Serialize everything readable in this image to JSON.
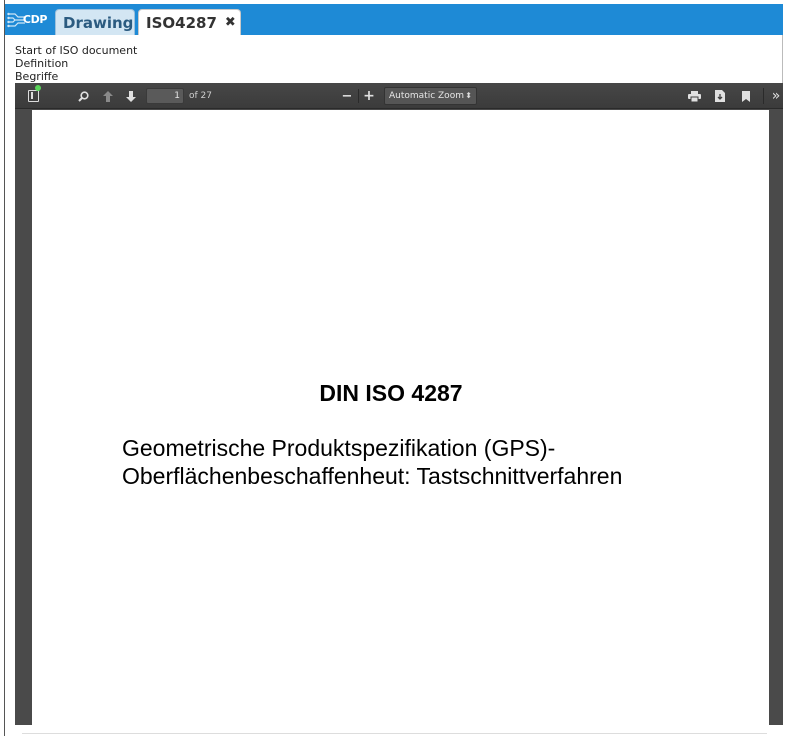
{
  "app": {
    "logo_text": "CDP"
  },
  "tabs": [
    {
      "label": "Drawing",
      "active": false
    },
    {
      "label": "ISO4287",
      "active": true,
      "close_icon": "close-icon"
    }
  ],
  "outline": {
    "items": [
      "Start of ISO document",
      "Definition",
      "Begriffe"
    ]
  },
  "pdf_toolbar": {
    "page_number": "1",
    "page_count_label": "of 27",
    "zoom_select": "Automatic Zoom",
    "icons": [
      "sidebar-toggle-icon",
      "search-icon",
      "previous-page-icon",
      "next-page-icon",
      "zoom-out-icon",
      "zoom-in-icon",
      "print-icon",
      "download-icon",
      "bookmark-icon",
      "tools-icon"
    ]
  },
  "document": {
    "title": "DIN ISO 4287",
    "subtitle_line1": "Geometrische Produktspezifikation (GPS)-",
    "subtitle_line2": "Oberflächenbeschaffenheut: Tastschnittverfahren"
  },
  "colors": {
    "tabbar": "#1e8ad6",
    "toolbar": "#3f3f3f",
    "viewer_bg": "#4a4a4a"
  }
}
